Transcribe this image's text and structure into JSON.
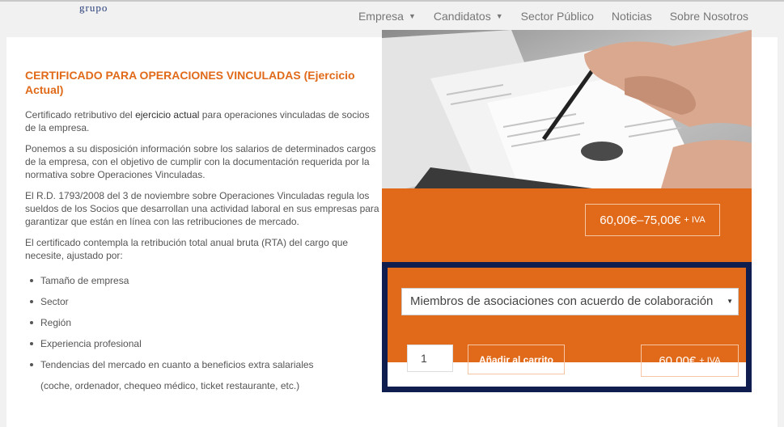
{
  "header": {
    "logo_fragment": "grupo",
    "nav": [
      {
        "label": "Empresa",
        "has_dropdown": true
      },
      {
        "label": "Candidatos",
        "has_dropdown": true
      },
      {
        "label": "Sector Público",
        "has_dropdown": false
      },
      {
        "label": "Noticias",
        "has_dropdown": false
      },
      {
        "label": "Sobre Nosotros",
        "has_dropdown": false
      }
    ]
  },
  "product": {
    "title": "CERTIFICADO PARA OPERACIONES VINCULADAS (Ejercicio Actual)",
    "p1_pre": "Certificado retributivo del ",
    "p1_bold": "ejercicio actual",
    "p1_post": " para operaciones vinculadas de socios de la empresa.",
    "p2": "Ponemos a su disposición información sobre los salarios de determinados cargos de la empresa, con el objetivo de cumplir con la documentación requerida por la normativa sobre Operaciones Vinculadas.",
    "p3": "El R.D. 1793/2008 del 3 de noviembre sobre Operaciones Vinculadas regula los sueldos de los Socios que desarrollan una actividad laboral en sus empresas para garantizar que están en línea con las retribuciones de mercado.",
    "p4": "El certificado contempla la retribución total anual bruta (RTA) del cargo que necesite, ajustado por:",
    "bullets": [
      "Tamaño de empresa",
      "Sector",
      "Región",
      "Experiencia profesional",
      "Tendencias del mercado en cuanto a beneficios extra salariales"
    ],
    "bullet_continuation": "(coche, ordenador, chequeo médico, ticket restaurante, etc.)"
  },
  "purchase": {
    "price_range": "60,00€–75,00€",
    "price_range_suffix": "+ IVA",
    "select_value": "Miembros de asociaciones con acuerdo de colaboración",
    "quantity": "1",
    "add_to_cart_label": "Añadir al carrito",
    "price": "60,00€",
    "price_suffix": "+ IVA",
    "accent_color": "#e06a19",
    "highlight_color": "#0f1e4e"
  }
}
